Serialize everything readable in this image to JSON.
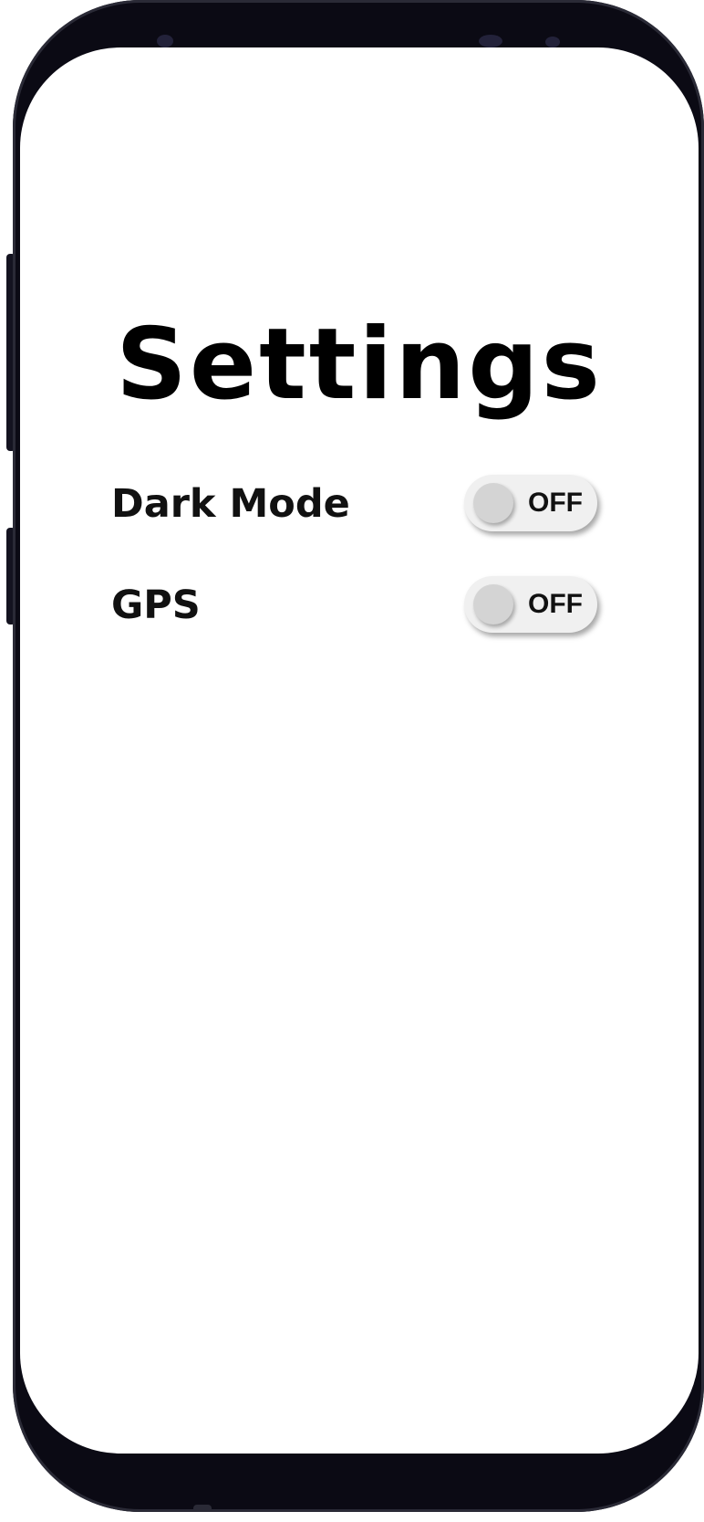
{
  "screen": {
    "title": "Settings"
  },
  "settings": [
    {
      "label": "Dark Mode",
      "toggle_state": "OFF",
      "enabled": false
    },
    {
      "label": "GPS",
      "toggle_state": "OFF",
      "enabled": false
    }
  ],
  "colors": {
    "frame": "#0b0a14",
    "screen_bg": "#ffffff",
    "toggle_track": "#f0f0f0",
    "toggle_knob": "#d4d4d4",
    "text": "#000000"
  }
}
